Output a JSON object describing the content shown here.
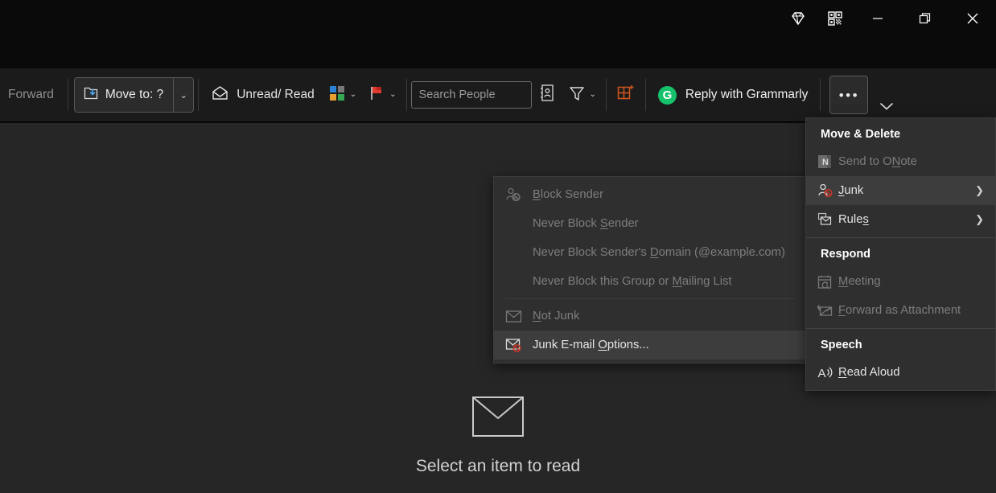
{
  "titlebar": {
    "buttons": [
      {
        "name": "diamond-icon",
        "label": "Diamond"
      },
      {
        "name": "qr-code-icon",
        "label": "QR Code"
      },
      {
        "name": "minimize-button",
        "label": "Minimize"
      },
      {
        "name": "restore-button",
        "label": "Restore"
      },
      {
        "name": "close-button",
        "label": "Close"
      }
    ]
  },
  "toolbar": {
    "forward_label": "Forward",
    "move_to_label": "Move to: ?",
    "unread_read_label": "Unread/ Read",
    "categorize_label": "Categorize",
    "follow_up_label": "Follow Up",
    "search_people_placeholder": "Search People",
    "address_book_label": "Address Book",
    "filter_email_label": "Filter Email",
    "new_group_label": "New Group",
    "grammarly_label": "Reply with Grammarly",
    "grammarly_mark": "G",
    "grammarly_color": "#15c26b",
    "overflow_label": "•••",
    "collapse_ribbon_label": "Collapse Ribbon",
    "caret": "⌄"
  },
  "reading_pane": {
    "empty_text": "Select an item to read",
    "envelope_icon": "envelope-icon"
  },
  "overflow_menu": {
    "sections": [
      {
        "header": "Move & Delete",
        "items": [
          {
            "icon": "onenote-icon",
            "label_pre": "Send to O",
            "label_key": "N",
            "label_post": "ote",
            "disabled": true,
            "submenu": false,
            "highlight": false
          },
          {
            "icon": "junk-icon",
            "label_pre": "",
            "label_key": "J",
            "label_post": "unk",
            "disabled": false,
            "submenu": true,
            "highlight": true
          },
          {
            "icon": "rules-icon",
            "label_pre": "Rule",
            "label_key": "s",
            "label_post": "",
            "disabled": false,
            "submenu": true,
            "highlight": false
          }
        ]
      },
      {
        "header": "Respond",
        "items": [
          {
            "icon": "meeting-icon",
            "label_pre": "",
            "label_key": "M",
            "label_post": "eeting",
            "disabled": true,
            "submenu": false,
            "highlight": false
          },
          {
            "icon": "forward-attachment-icon",
            "label_pre": "",
            "label_key": "F",
            "label_post": "orward as Attachment",
            "disabled": true,
            "submenu": false,
            "highlight": false
          }
        ]
      },
      {
        "header": "Speech",
        "items": [
          {
            "icon": "read-aloud-icon",
            "label_pre": "",
            "label_key": "R",
            "label_post": "ead Aloud",
            "disabled": false,
            "submenu": false,
            "highlight": false
          }
        ]
      }
    ]
  },
  "junk_submenu": {
    "items": [
      {
        "icon": "block-sender-icon",
        "label_pre": "",
        "label_key": "B",
        "label_post": "lock Sender",
        "disabled": true,
        "indent": false,
        "highlight": false,
        "divider_after": false
      },
      {
        "icon": "",
        "label_pre": "Never Block ",
        "label_key": "S",
        "label_post": "ender",
        "disabled": true,
        "indent": true,
        "highlight": false,
        "divider_after": false
      },
      {
        "icon": "",
        "label_pre": "Never Block Sender's ",
        "label_key": "D",
        "label_post": "omain (@example.com)",
        "disabled": true,
        "indent": true,
        "highlight": false,
        "divider_after": false
      },
      {
        "icon": "",
        "label_pre": "Never Block this Group or ",
        "label_key": "M",
        "label_post": "ailing List",
        "disabled": true,
        "indent": true,
        "highlight": false,
        "divider_after": true
      },
      {
        "icon": "not-junk-icon",
        "label_pre": "",
        "label_key": "N",
        "label_post": "ot Junk",
        "disabled": true,
        "indent": false,
        "highlight": false,
        "divider_after": false
      },
      {
        "icon": "junk-email-options-icon",
        "label_pre": "Junk E-mail ",
        "label_key": "O",
        "label_post": "ptions...",
        "disabled": false,
        "indent": false,
        "highlight": true,
        "divider_after": false
      }
    ]
  }
}
